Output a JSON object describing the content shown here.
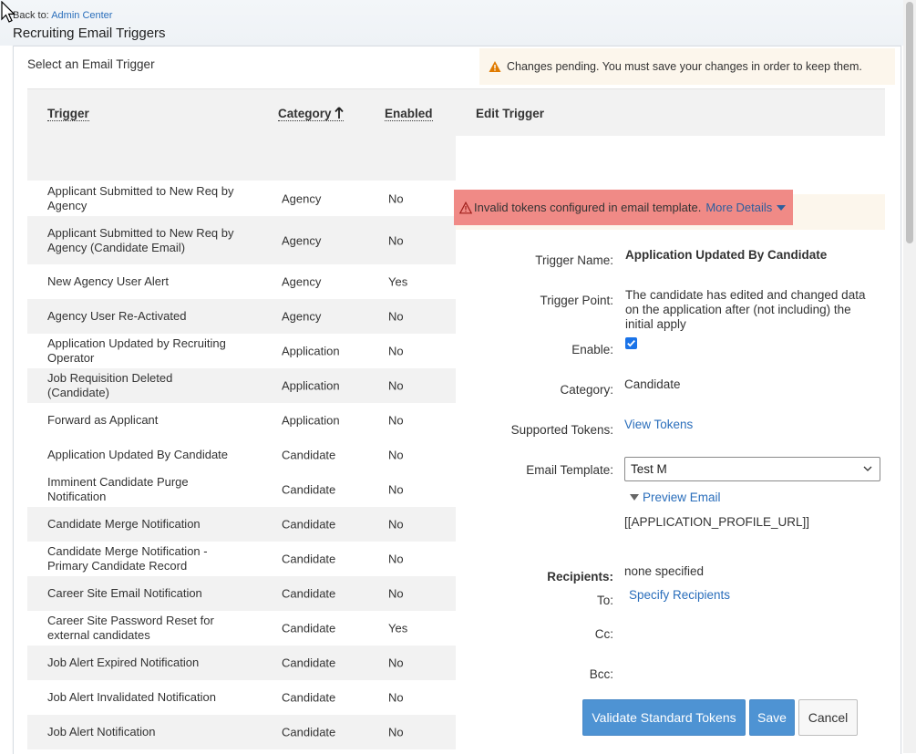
{
  "breadcrumb": {
    "prefix": "Back to: ",
    "link": "Admin Center"
  },
  "page_title": "Recruiting Email Triggers",
  "select_label": "Select an Email Trigger",
  "pending_message": "Changes pending. You must save your changes in order to keep them.",
  "table": {
    "headers": {
      "trigger": "Trigger",
      "category": "Category",
      "enabled": "Enabled",
      "edit": "Edit Trigger"
    },
    "sort": {
      "column": "category",
      "direction": "ascending"
    },
    "rows": [
      {
        "trigger": "Applicant Submitted to New Req by Agency",
        "category": "Agency",
        "enabled": "No"
      },
      {
        "trigger": "Applicant Submitted to New Req by Agency (Candidate Email)",
        "category": "Agency",
        "enabled": "No"
      },
      {
        "trigger": "New Agency User Alert",
        "category": "Agency",
        "enabled": "Yes"
      },
      {
        "trigger": "Agency User Re-Activated",
        "category": "Agency",
        "enabled": "No"
      },
      {
        "trigger": "Application Updated by Recruiting Operator",
        "category": "Application",
        "enabled": "No"
      },
      {
        "trigger": "Job Requisition Deleted (Candidate)",
        "category": "Application",
        "enabled": "No"
      },
      {
        "trigger": "Forward as Applicant",
        "category": "Application",
        "enabled": "No"
      },
      {
        "trigger": "Application Updated By Candidate",
        "category": "Candidate",
        "enabled": "No",
        "selected": true
      },
      {
        "trigger": "Imminent Candidate Purge Notification",
        "category": "Candidate",
        "enabled": "No"
      },
      {
        "trigger": "Candidate Merge Notification",
        "category": "Candidate",
        "enabled": "No"
      },
      {
        "trigger": "Candidate Merge Notification - Primary Candidate Record",
        "category": "Candidate",
        "enabled": "No"
      },
      {
        "trigger": "Career Site Email Notification",
        "category": "Candidate",
        "enabled": "No"
      },
      {
        "trigger": "Career Site Password Reset for external candidates",
        "category": "Candidate",
        "enabled": "Yes"
      },
      {
        "trigger": "Job Alert Expired Notification",
        "category": "Candidate",
        "enabled": "No"
      },
      {
        "trigger": "Job Alert Invalidated Notification",
        "category": "Candidate",
        "enabled": "No"
      },
      {
        "trigger": "Job Alert Notification",
        "category": "Candidate",
        "enabled": "No"
      }
    ]
  },
  "edit": {
    "invalid_message": "Invalid tokens configured in email template.",
    "more_details": "More Details",
    "labels": {
      "trigger_name": "Trigger Name:",
      "trigger_point": "Trigger Point:",
      "enable": "Enable:",
      "category": "Category:",
      "supported_tokens": "Supported Tokens:",
      "email_template": "Email Template:",
      "recipients": "Recipients:",
      "to": "To:",
      "cc": "Cc:",
      "bcc": "Bcc:"
    },
    "trigger_name": "Application Updated By Candidate",
    "trigger_point": "The candidate has edited and changed data on the application after (not including) the initial apply",
    "enabled": true,
    "category": "Candidate",
    "view_tokens": "View Tokens",
    "email_template": "Test M",
    "preview_email": "Preview Email",
    "token_text": "[[APPLICATION_PROFILE_URL]]",
    "recipients_value": "none specified",
    "specify_recipients": "Specify Recipients",
    "buttons": {
      "validate": "Validate Standard Tokens",
      "save": "Save",
      "cancel": "Cancel"
    }
  },
  "colors": {
    "link": "#2a6ebb",
    "primary_button": "#4e93d3",
    "error_banner": "#f08a86",
    "warning_bg": "#fcf6ec",
    "warning_icon": "#e07b00",
    "row_alt": "#f2f2f2"
  }
}
